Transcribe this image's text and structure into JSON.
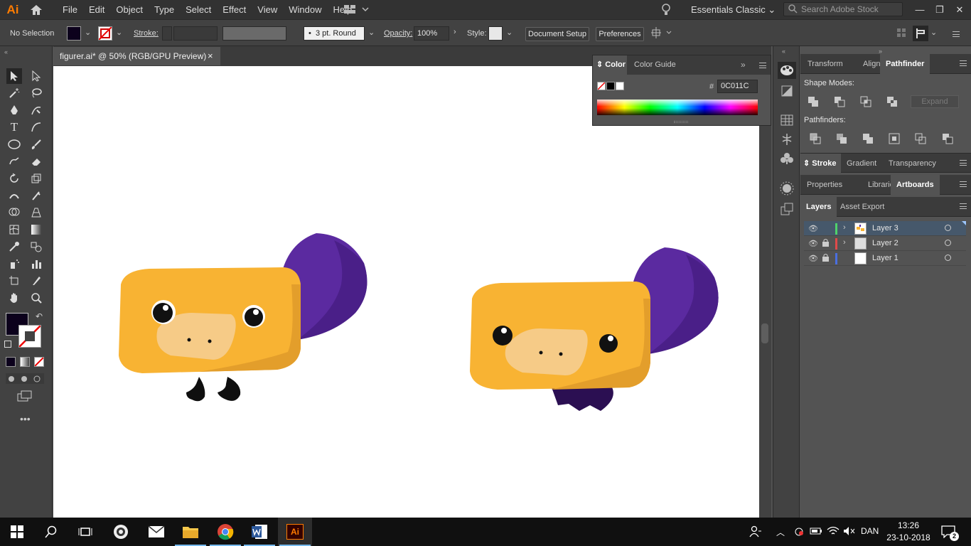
{
  "app": {
    "logo": "Ai"
  },
  "menus": [
    "File",
    "Edit",
    "Object",
    "Type",
    "Select",
    "Effect",
    "View",
    "Window",
    "Help"
  ],
  "workspace": "Essentials Classic",
  "search_placeholder": "Search Adobe Stock",
  "control_bar": {
    "selection": "No Selection",
    "stroke_label": "Stroke:",
    "brush": "3 pt. Round",
    "opacity_label": "Opacity:",
    "opacity": "100%",
    "style_label": "Style:",
    "document_setup": "Document Setup",
    "preferences": "Preferences"
  },
  "document_tab": {
    "title": "figurer.ai* @ 50% (RGB/GPU Preview)",
    "close": "×"
  },
  "color_panel": {
    "tabs": [
      "Color",
      "Color Guide"
    ],
    "hash": "#",
    "hex": "0C011C",
    "fill_color": "#0C011C"
  },
  "panels": {
    "top_tabs": [
      "Transform",
      "Align",
      "Pathfinder"
    ],
    "shape_modes_label": "Shape Modes:",
    "expand": "Expand",
    "pathfinders_label": "Pathfinders:",
    "stroke_tabs": [
      "Stroke",
      "Gradient",
      "Transparency"
    ],
    "prop_tabs": [
      "Properties",
      "Libraries",
      "Artboards"
    ],
    "layer_tabs": [
      "Layers",
      "Asset Export"
    ]
  },
  "layers": [
    {
      "name": "Layer 3",
      "color": "#4fd16b",
      "locked": false,
      "selected": true
    },
    {
      "name": "Layer 2",
      "color": "#e04a4a",
      "locked": true,
      "selected": false
    },
    {
      "name": "Layer 1",
      "color": "#4a6fe0",
      "locked": true,
      "selected": false
    }
  ],
  "taskbar": {
    "lang": "DAN",
    "time": "13:26",
    "date": "23-10-2018",
    "notifications": "2"
  },
  "colors": {
    "accent_orange": "#ff7c00",
    "duck_yellow": "#f8b333",
    "duck_purple": "#5b2aa0"
  }
}
